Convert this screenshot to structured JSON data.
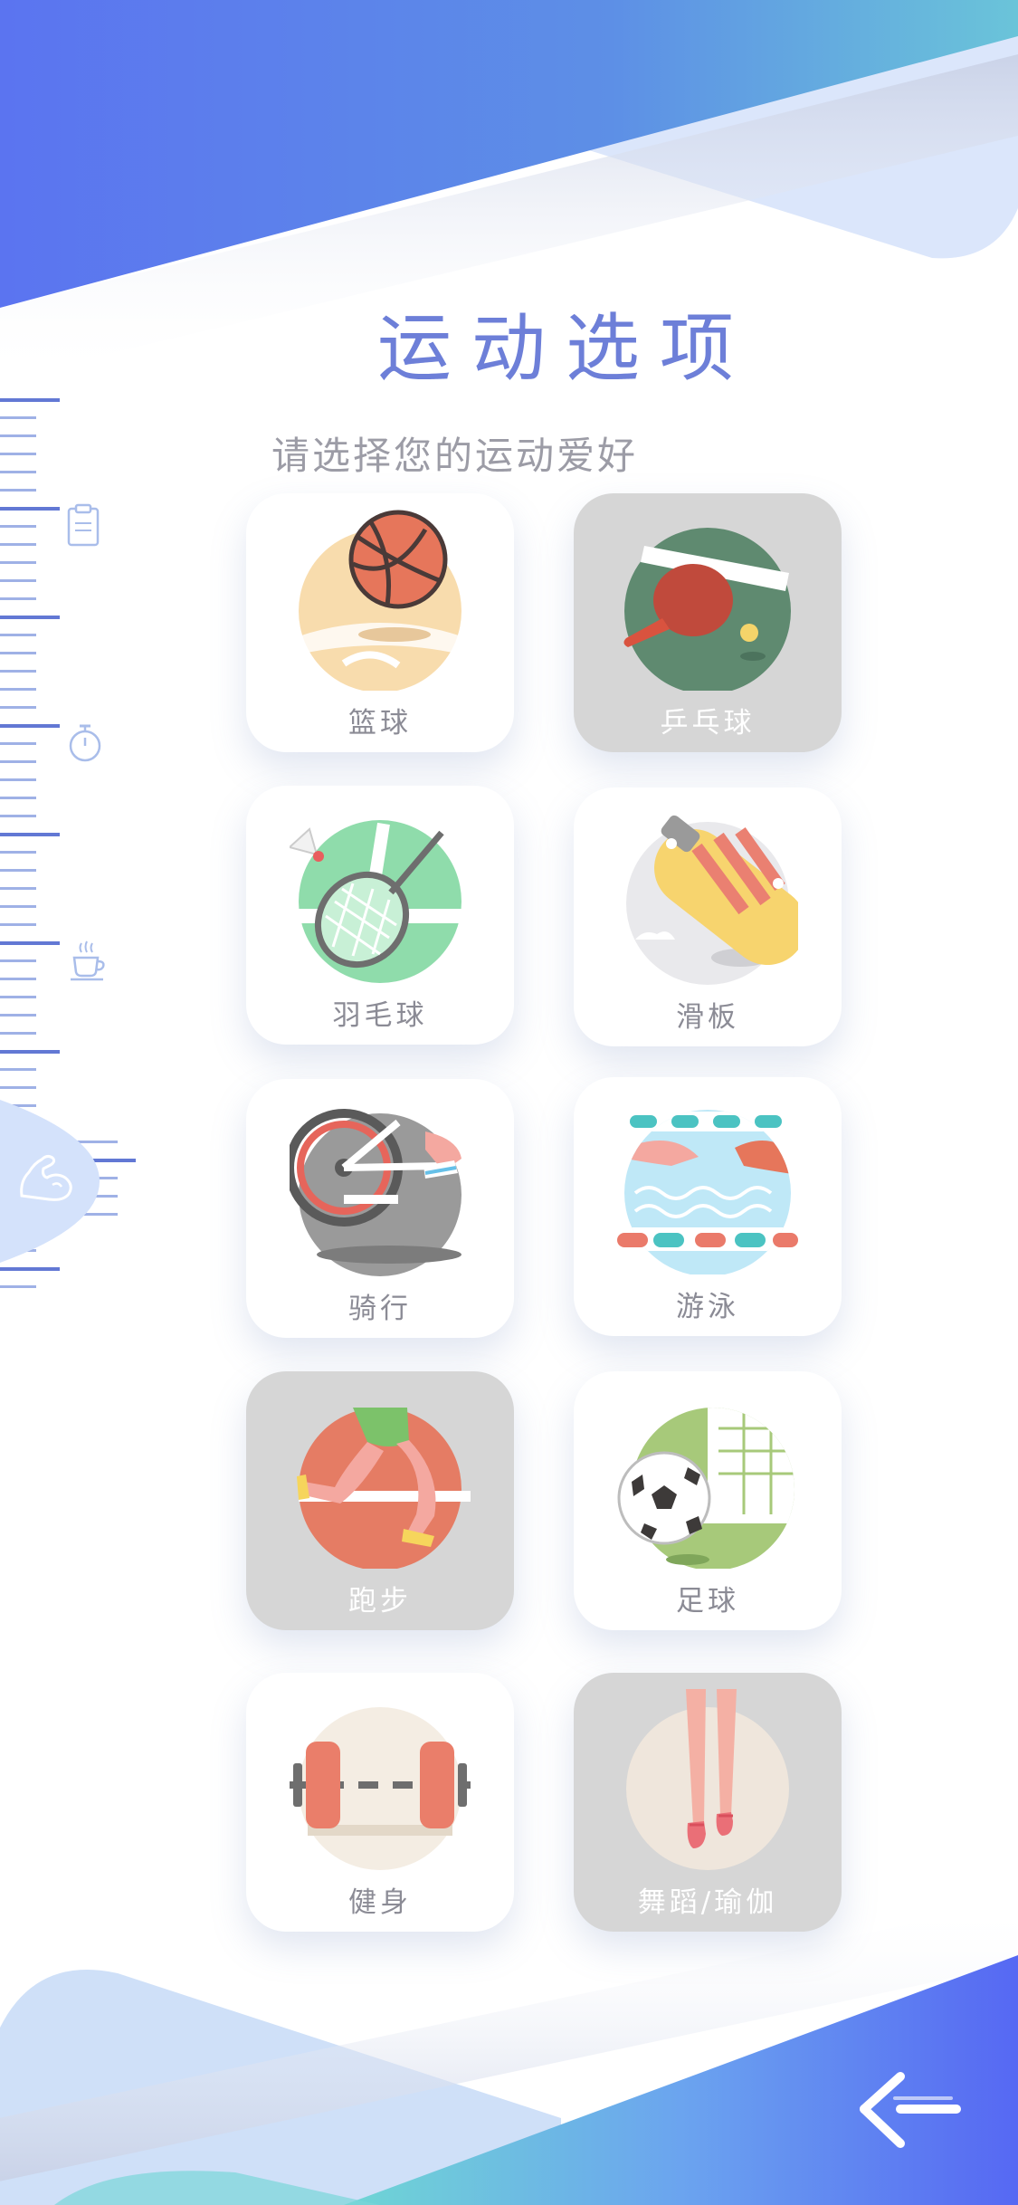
{
  "page": {
    "title": "运动选项",
    "subtitle": "请选择您的运动爱好"
  },
  "nav": {
    "items": [
      {
        "icon": "notepad-icon",
        "active": false
      },
      {
        "icon": "stopwatch-icon",
        "active": false
      },
      {
        "icon": "coffee-cup-icon",
        "active": false
      },
      {
        "icon": "muscle-arm-icon",
        "active": true
      }
    ]
  },
  "sports": [
    {
      "label": "篮球",
      "icon": "basketball-icon",
      "selected": false
    },
    {
      "label": "乒乓球",
      "icon": "ping-pong-icon",
      "selected": true
    },
    {
      "label": "羽毛球",
      "icon": "badminton-icon",
      "selected": false
    },
    {
      "label": "滑板",
      "icon": "skateboard-icon",
      "selected": false
    },
    {
      "label": "骑行",
      "icon": "cycling-icon",
      "selected": false
    },
    {
      "label": "游泳",
      "icon": "swimming-icon",
      "selected": false
    },
    {
      "label": "跑步",
      "icon": "running-icon",
      "selected": true
    },
    {
      "label": "足球",
      "icon": "soccer-icon",
      "selected": false
    },
    {
      "label": "健身",
      "icon": "dumbbell-icon",
      "selected": false
    },
    {
      "label": "舞蹈/瑜伽",
      "icon": "dance-yoga-icon",
      "selected": true
    }
  ],
  "colors": {
    "accent": "#6d7fd8",
    "selected_card": "#d6d6d6",
    "card": "#ffffff",
    "label": "#8b8b95"
  },
  "back_button": {
    "icon": "back-arrow-icon"
  }
}
